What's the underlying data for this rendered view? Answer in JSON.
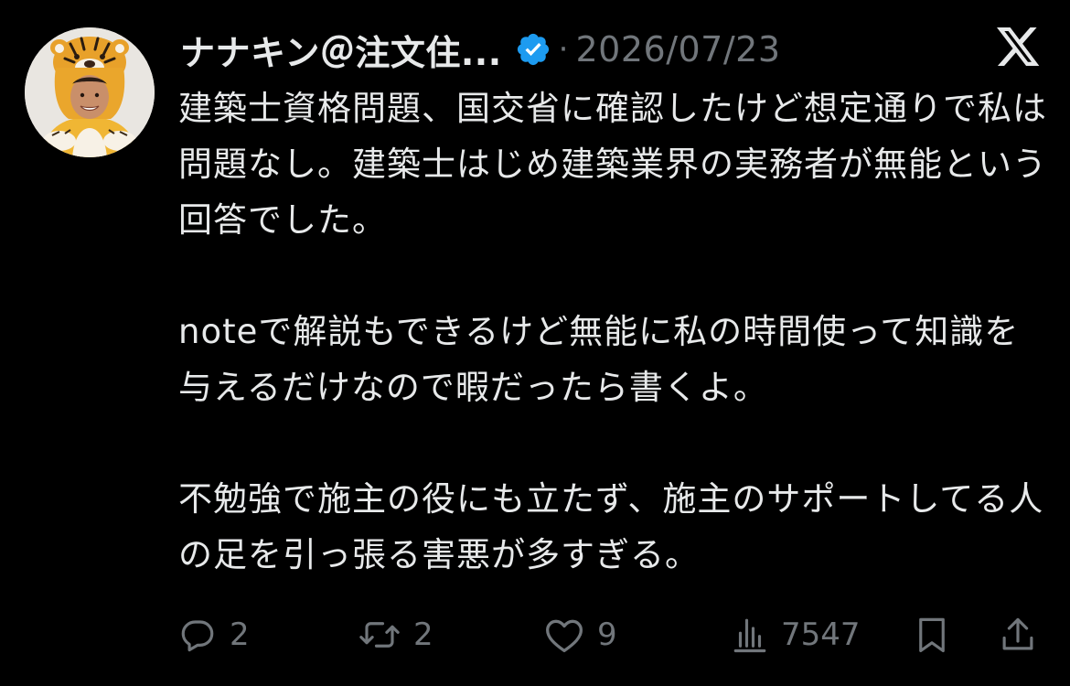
{
  "tweet": {
    "author_name": "ナナキン＠注文住...",
    "separator": "·",
    "date": "2026/07/23",
    "paragraphs": [
      "建築士資格問題、国交省に確認したけど想定通りで私は問題なし。建築士はじめ建築業界の実務者が無能という回答でした。",
      "noteで解説もできるけど無能に私の時間使って知識を与えるだけなので暇だったら書くよ。",
      "不勉強で施主の役にも立たず、施主のサポートしてる人の足を引っ張る害悪が多すぎる。"
    ]
  },
  "actions": {
    "replies": "2",
    "reposts": "2",
    "likes": "9",
    "views": "7547"
  },
  "icons": {
    "avatar": "avatar-tiger-costume",
    "verified": "verified-badge-icon",
    "logo": "x-logo-icon",
    "reply": "reply-icon",
    "repost": "repost-icon",
    "like": "heart-icon",
    "views": "views-icon",
    "bookmark": "bookmark-icon",
    "share": "share-icon"
  },
  "colors": {
    "background": "#000000",
    "text": "#e7e9ea",
    "muted": "#71767b",
    "verified": "#1d9bf0"
  }
}
